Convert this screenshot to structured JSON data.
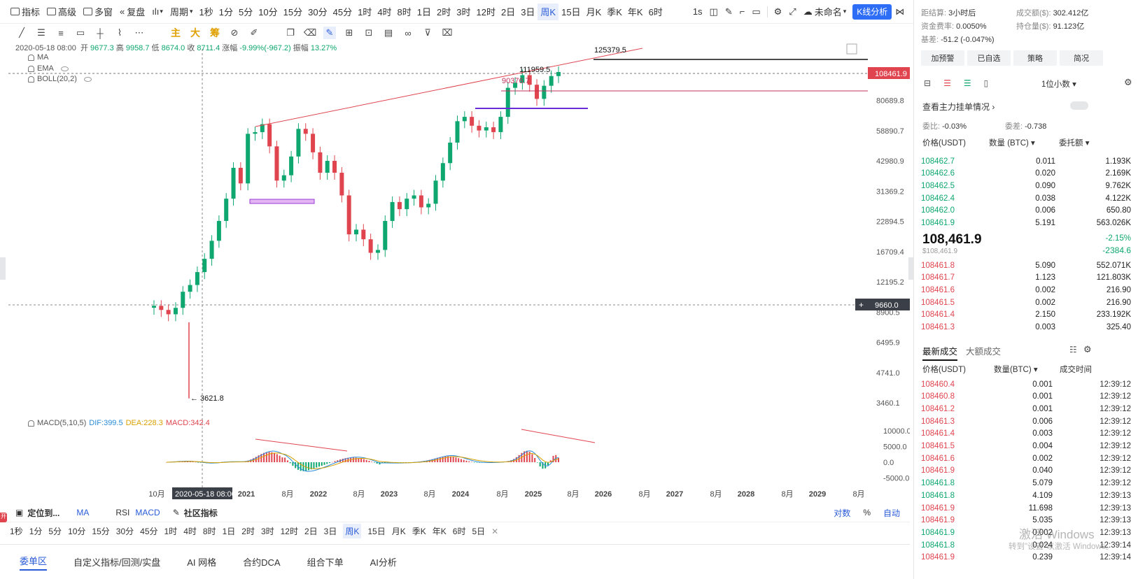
{
  "toolbar": {
    "items": [
      "指标",
      "高级",
      "多窗",
      "复盘",
      "周期"
    ],
    "timeframes": [
      "1秒",
      "1分",
      "5分",
      "10分",
      "15分",
      "30分",
      "45分",
      "1时",
      "4时",
      "8时",
      "1日",
      "2时",
      "3时",
      "12时",
      "2日",
      "3日",
      "周K",
      "15日",
      "月K",
      "季K",
      "年K",
      "6时"
    ],
    "active_timeframe": "周K",
    "right_items": [
      "1s",
      "未命名"
    ],
    "kline_btn": "K线分析"
  },
  "drawbar": {
    "main_labels": [
      "主",
      "大",
      "筹"
    ]
  },
  "info": {
    "date": "2020-05-18 08:00",
    "open_label": "开",
    "open": "9677.3",
    "high_label": "高",
    "high": "9958.7",
    "low_label": "低",
    "low": "8674.0",
    "close_label": "收",
    "close": "8711.4",
    "change_label": "涨幅",
    "change": "-9.99%(-967.2)",
    "amp_label": "振幅",
    "amp": "13.27%",
    "indicators": [
      "MA",
      "EMA",
      "BOLL(20,2)"
    ]
  },
  "chart_data": {
    "type": "candlestick",
    "y_scale": "log",
    "price_axis_ticks": [
      "80689.8",
      "58890.7",
      "42980.9",
      "31369.2",
      "22894.5",
      "16709.4",
      "12195.2",
      "8900.5",
      "6495.9",
      "4741.0",
      "3460.1"
    ],
    "x_axis_ticks": [
      "10月",
      "2021",
      "8月",
      "2022",
      "8月",
      "2023",
      "8月",
      "2024",
      "8月",
      "2025",
      "8月",
      "2026",
      "8月",
      "2027",
      "8月",
      "2028",
      "8月",
      "2029",
      "8月"
    ],
    "crosshair_label": "2020-05-18 08:00",
    "annotations": [
      "125379.5",
      "111959.5",
      "90376.7",
      "3621.8"
    ],
    "current_price": "108461.9",
    "crosshair_price": "9660.0",
    "series_close_approx": [
      9500,
      9100,
      8700,
      9300,
      11000,
      11800,
      13500,
      15500,
      18700,
      23000,
      29000,
      40000,
      34000,
      57000,
      58000,
      63000,
      50000,
      35000,
      37000,
      45000,
      60000,
      57000,
      47000,
      38000,
      43000,
      38000,
      30000,
      20000,
      21000,
      19000,
      16500,
      17000,
      23000,
      28000,
      26000,
      29000,
      30000,
      26500,
      27500,
      35000,
      42000,
      52000,
      65000,
      68000,
      62000,
      59000,
      61000,
      58000,
      68000,
      92000,
      97000,
      105000,
      95000,
      82000,
      94000,
      104000,
      108461.9
    ],
    "macd": {
      "label": "MACD(5,10,5)",
      "dif_label": "DIF:399.5",
      "dea_label": "DEA:228.3",
      "macd_label": "MACD:342.4",
      "ticks": [
        "10000.0",
        "5000.0",
        "0.0",
        "-5000.0"
      ]
    }
  },
  "bottom1": {
    "locate": "定位到...",
    "ma": "MA",
    "rsi": "RSI",
    "macd": "MACD",
    "community": "社区指标",
    "right": [
      "对数",
      "%",
      "自动"
    ]
  },
  "bottom2": {
    "timeframes": [
      "1秒",
      "1分",
      "5分",
      "10分",
      "15分",
      "30分",
      "45分",
      "1时",
      "4时",
      "8时",
      "1日",
      "2时",
      "3时",
      "12时",
      "2日",
      "3日",
      "周K",
      "15日",
      "月K",
      "季K",
      "年K",
      "6时",
      "5日"
    ],
    "active": "周K"
  },
  "bottom_tabs": [
    "委单区",
    "自定义指标/回测/实盘",
    "AI 网格",
    "合约DCA",
    "组合下单",
    "AI分析"
  ],
  "right": {
    "settle_label": "距结算:",
    "settle": "3小时后",
    "volume_label": "成交额($):",
    "volume": "302.412亿",
    "funding_label": "资金费率:",
    "funding": "0.0050%",
    "oi_label": "持仓量($):",
    "oi": "91.123亿",
    "basis_label": "基差:",
    "basis": "-51.2 (-0.047%)",
    "buttons": [
      "加预警",
      "已自选",
      "策略",
      "简况"
    ],
    "precision": "1位小数",
    "check_main": "查看主力挂单情况",
    "ratio_label": "委比:",
    "ratio": "-0.03%",
    "diff_label": "委差:",
    "diff": "-0.738",
    "ob_headers": [
      "价格(USDT)",
      "数量 (BTC)",
      "委托额"
    ],
    "asks": [
      [
        "108462.7",
        "0.011",
        "1.193K"
      ],
      [
        "108462.6",
        "0.020",
        "2.169K"
      ],
      [
        "108462.5",
        "0.090",
        "9.762K"
      ],
      [
        "108462.4",
        "0.038",
        "4.122K"
      ],
      [
        "108462.0",
        "0.006",
        "650.80"
      ],
      [
        "108461.9",
        "5.191",
        "563.026K"
      ]
    ],
    "last_price": "108,461.9",
    "last_sub": "$108,461.9",
    "change_pct": "-2.15%",
    "change_abs": "-2384.6",
    "bids": [
      [
        "108461.8",
        "5.090",
        "552.071K"
      ],
      [
        "108461.7",
        "1.123",
        "121.803K"
      ],
      [
        "108461.6",
        "0.002",
        "216.90"
      ],
      [
        "108461.5",
        "0.002",
        "216.90"
      ],
      [
        "108461.4",
        "2.150",
        "233.192K"
      ],
      [
        "108461.3",
        "0.003",
        "325.40"
      ]
    ],
    "trade_tabs": [
      "最新成交",
      "大额成交"
    ],
    "trade_headers": [
      "价格(USDT)",
      "数量(BTC)",
      "成交时间"
    ],
    "trades": [
      [
        "108460.4",
        "0.001",
        "12:39:12",
        "red"
      ],
      [
        "108460.8",
        "0.001",
        "12:39:12",
        "red"
      ],
      [
        "108461.2",
        "0.001",
        "12:39:12",
        "red"
      ],
      [
        "108461.3",
        "0.006",
        "12:39:12",
        "red"
      ],
      [
        "108461.4",
        "0.003",
        "12:39:12",
        "red"
      ],
      [
        "108461.5",
        "0.004",
        "12:39:12",
        "red"
      ],
      [
        "108461.6",
        "0.002",
        "12:39:12",
        "red"
      ],
      [
        "108461.9",
        "0.040",
        "12:39:12",
        "red"
      ],
      [
        "108461.8",
        "5.079",
        "12:39:12",
        "green"
      ],
      [
        "108461.8",
        "4.109",
        "12:39:13",
        "green"
      ],
      [
        "108461.9",
        "11.698",
        "12:39:13",
        "red"
      ],
      [
        "108461.9",
        "5.035",
        "12:39:13",
        "red"
      ],
      [
        "108461.9",
        "0.002",
        "12:39:13",
        "green"
      ],
      [
        "108461.8",
        "0.024",
        "12:39:14",
        "green"
      ],
      [
        "108461.9",
        "0.239",
        "12:39:14",
        "red"
      ]
    ],
    "watermark1": "激活 Windows",
    "watermark2": "转到\"设置\"以激活 Windows。"
  }
}
